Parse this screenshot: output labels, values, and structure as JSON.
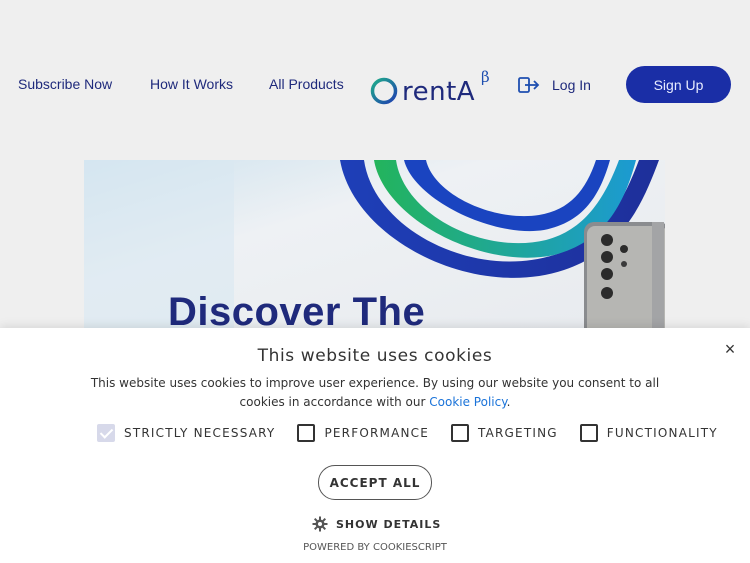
{
  "nav": {
    "subscribe": "Subscribe Now",
    "how_it_works": "How It Works",
    "all_products": "All Products",
    "login": "Log In",
    "signup": "Sign Up"
  },
  "logo": {
    "text": "rentA",
    "beta": "β"
  },
  "hero": {
    "title": "Discover The"
  },
  "cookie": {
    "title": "This website uses cookies",
    "text": "This website uses cookies to improve user experience. By using our website you consent to all cookies in accordance with our Cookie Policy.",
    "link": "Cookie Policy",
    "options": [
      {
        "label": "STRICTLY NECESSARY",
        "checked": true
      },
      {
        "label": "PERFORMANCE",
        "checked": false
      },
      {
        "label": "TARGETING",
        "checked": false
      },
      {
        "label": "FUNCTIONALITY",
        "checked": false
      }
    ],
    "accept": "ACCEPT ALL",
    "details": "SHOW DETAILS",
    "powered": "POWERED BY COOKIESCRIPT",
    "close": "×"
  },
  "colors": {
    "brand": "#1f2a7c",
    "signup_bg": "#1a2ea6",
    "link": "#1a73d9"
  }
}
